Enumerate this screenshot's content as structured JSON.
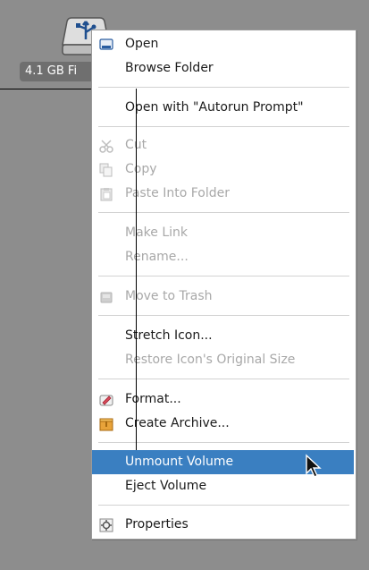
{
  "desktop": {
    "drive_label": "4.1 GB Fi"
  },
  "menu": {
    "open": "Open",
    "browse_folder": "Browse Folder",
    "open_with": "Open with \"Autorun Prompt\"",
    "cut": "Cut",
    "copy": "Copy",
    "paste": "Paste Into Folder",
    "make_link": "Make Link",
    "rename": "Rename...",
    "move_to_trash": "Move to Trash",
    "stretch_icon": "Stretch Icon...",
    "restore_icon": "Restore Icon's Original Size",
    "format": "Format...",
    "create_archive": "Create Archive...",
    "unmount": "Unmount Volume",
    "eject": "Eject Volume",
    "properties": "Properties"
  },
  "colors": {
    "highlight": "#3a7fc1",
    "disabled_text": "#a8a8a8"
  }
}
